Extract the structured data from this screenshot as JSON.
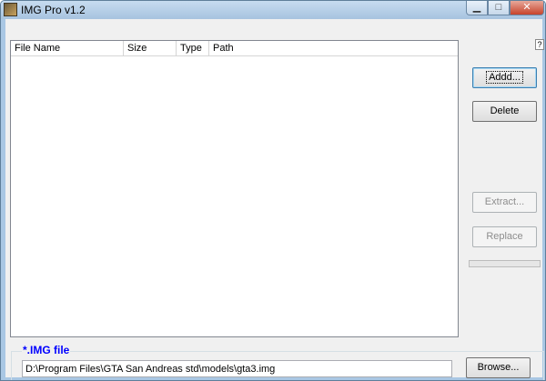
{
  "window": {
    "title": "IMG Pro v1.2",
    "minimize_glyph": "▁",
    "maximize_glyph": "□",
    "close_glyph": "✕",
    "help_glyph": "?"
  },
  "file_list": {
    "columns": [
      "File Name",
      "Size",
      "Type",
      "Path"
    ],
    "rows": []
  },
  "buttons": {
    "add": "Addd...",
    "delete": "Delete",
    "extract": "Extract...",
    "replace": "Replace",
    "browse": "Browse..."
  },
  "progress": {
    "value": 0
  },
  "img_file": {
    "label": "*.IMG file",
    "path": "D:\\Program Files\\GTA San Andreas std\\models\\gta3.img"
  },
  "colors": {
    "label_blue": "#0000ff",
    "title_gradient_top": "#c7dcf0",
    "close_red": "#c7432b"
  }
}
